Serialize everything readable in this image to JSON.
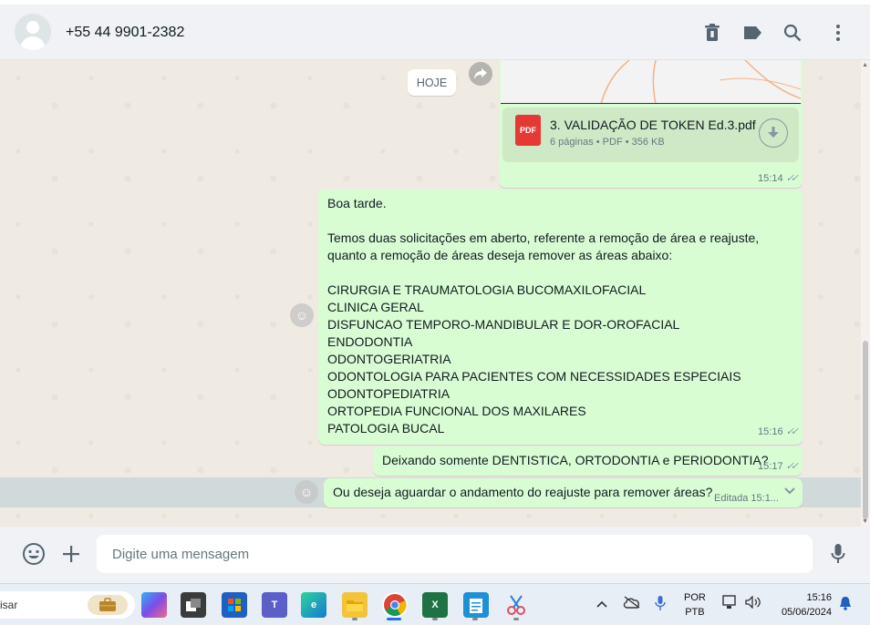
{
  "header": {
    "contact_name": "+55 44 9901-2382",
    "icons": [
      "delete-archive-icon",
      "label-icon",
      "search-icon",
      "menu-kebab-icon"
    ]
  },
  "chat": {
    "date_chip": "HOJE",
    "document_message": {
      "file_name": "3. VALIDAÇÃO DE TOKEN Ed.3.pdf",
      "file_type_badge": "PDF",
      "meta": "6 páginas • PDF • 356 KB",
      "time": "15:14"
    },
    "message_2": {
      "lines": [
        "Boa tarde.",
        "",
        "Temos duas solicitações em aberto, referente a remoção de área e reajuste,",
        "quanto a remoção de áreas deseja remover as áreas abaixo:",
        "",
        "CIRURGIA E TRAUMATOLOGIA BUCOMAXILOFACIAL",
        "CLINICA GERAL",
        "DISFUNCAO TEMPORO-MANDIBULAR E DOR-OROFACIAL",
        "ENDODONTIA",
        "ODONTOGERIATRIA",
        "ODONTOLOGIA PARA PACIENTES COM NECESSIDADES ESPECIAIS",
        "ODONTOPEDIATRIA",
        "ORTOPEDIA FUNCIONAL DOS MAXILARES",
        "PATOLOGIA BUCAL"
      ],
      "time": "15:16"
    },
    "message_3": {
      "text": "Deixando somente DENTISTICA, ORTODONTIA e PERIODONTIA?",
      "time": "15:17"
    },
    "message_4": {
      "text": "Ou deseja aguardar o andamento do reajuste para remover áreas?",
      "edited_label": "Editada 15:1..."
    }
  },
  "composer": {
    "placeholder": "Digite uma mensagem"
  },
  "taskbar": {
    "search_text": "isar",
    "language": "POR",
    "keyboard": "PTB",
    "time": "15:16",
    "date": "05/06/2024"
  }
}
